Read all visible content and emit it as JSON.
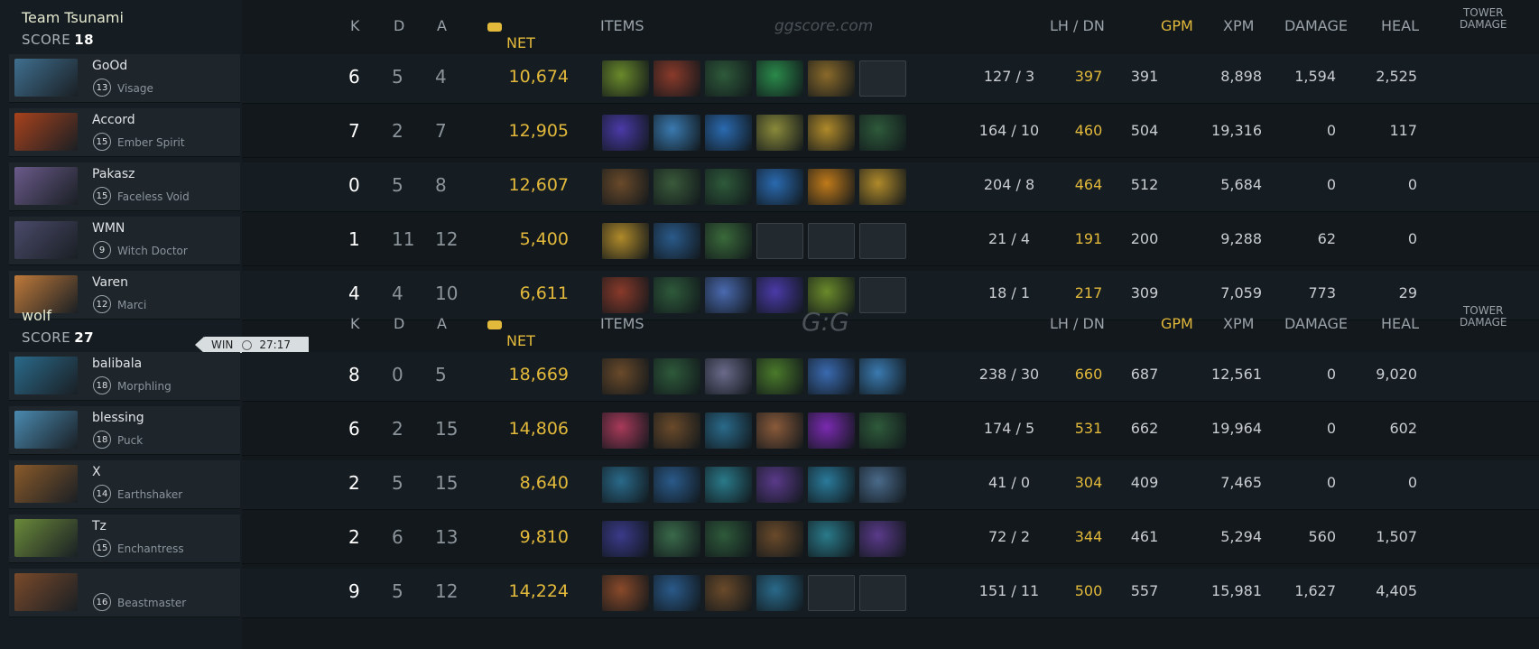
{
  "teams": [
    {
      "name": "Team Tsunami",
      "score_label": "SCORE",
      "score": "18",
      "headers": {
        "k": "K",
        "d": "D",
        "a": "A",
        "net": "NET",
        "items": "ITEMS",
        "lh": "LH  /  DN",
        "gpm": "GPM",
        "xpm": "XPM",
        "damage": "DAMAGE",
        "heal": "HEAL",
        "tower1": "TOWER",
        "tower2": "DAMAGE",
        "logo": "ggscore.com"
      },
      "players": [
        {
          "name": "GoOd",
          "level": "13",
          "hero": "Visage",
          "k": "6",
          "d": "5",
          "a": "4",
          "net": "10,674",
          "lh": "127  /  3",
          "gpm": "397",
          "xpm": "391",
          "damage": "8,898",
          "heal": "1,594",
          "tower": "2,525",
          "portrait": "#3f6f8f",
          "items": [
            "#6a8a2a",
            "#8a3a2a",
            "#2e5a3a",
            "#2a8a4a",
            "#8a6a2a",
            ""
          ]
        },
        {
          "name": "Accord",
          "level": "15",
          "hero": "Ember Spirit",
          "k": "7",
          "d": "2",
          "a": "7",
          "net": "12,905",
          "lh": "164  /  10",
          "gpm": "460",
          "xpm": "504",
          "damage": "19,316",
          "heal": "0",
          "tower": "117",
          "portrait": "#a8421c",
          "items": [
            "#4a3aa8",
            "#3a7ab0",
            "#2a6ab0",
            "#8a8a3a",
            "#b08a2a",
            "#2e5a3a"
          ]
        },
        {
          "name": "Pakasz",
          "level": "15",
          "hero": "Faceless Void",
          "k": "0",
          "d": "5",
          "a": "8",
          "net": "12,607",
          "lh": "204  /  8",
          "gpm": "464",
          "xpm": "512",
          "damage": "5,684",
          "heal": "0",
          "tower": "0",
          "portrait": "#6a5a8a",
          "items": [
            "#6a4a2a",
            "#3a5a3a",
            "#2e5a3a",
            "#2a6ab0",
            "#c07a1a",
            "#b08a2a"
          ]
        },
        {
          "name": "WMN",
          "level": "9",
          "hero": "Witch Doctor",
          "k": "1",
          "d": "11",
          "a": "12",
          "net": "5,400",
          "lh": "21  /  4",
          "gpm": "191",
          "xpm": "200",
          "damage": "9,288",
          "heal": "62",
          "tower": "0",
          "portrait": "#4a4a6a",
          "items": [
            "#b08a2a",
            "#2a5a8a",
            "#3a6a3a",
            "",
            "",
            ""
          ]
        },
        {
          "name": "Varen",
          "level": "12",
          "hero": "Marci",
          "k": "4",
          "d": "4",
          "a": "10",
          "net": "6,611",
          "lh": "18  /  1",
          "gpm": "217",
          "xpm": "309",
          "damage": "7,059",
          "heal": "773",
          "tower": "29",
          "portrait": "#c07a3a",
          "items": [
            "#8a3a2a",
            "#2e5a3a",
            "#4a6ab0",
            "#4a3aa8",
            "#6a8a2a",
            ""
          ]
        }
      ]
    },
    {
      "name": "wolf",
      "score_label": "SCORE",
      "score": "27",
      "win": "WIN",
      "time": "27:17",
      "headers": {
        "k": "K",
        "d": "D",
        "a": "A",
        "net": "NET",
        "items": "ITEMS",
        "lh": "LH  /  DN",
        "gpm": "GPM",
        "xpm": "XPM",
        "damage": "DAMAGE",
        "heal": "HEAL",
        "tower1": "TOWER",
        "tower2": "DAMAGE",
        "logo": "G:G"
      },
      "players": [
        {
          "name": "balibala",
          "level": "18",
          "hero": "Morphling",
          "k": "8",
          "d": "0",
          "a": "5",
          "net": "18,669",
          "lh": "238  /  30",
          "gpm": "660",
          "xpm": "687",
          "damage": "12,561",
          "heal": "0",
          "tower": "9,020",
          "portrait": "#2a6a8a",
          "items": [
            "#6a4a2a",
            "#2e5a3a",
            "#6a6a8a",
            "#4a7a2a",
            "#3a6ab0",
            "#3a7ab0"
          ]
        },
        {
          "name": "blessing",
          "level": "18",
          "hero": "Puck",
          "k": "6",
          "d": "2",
          "a": "15",
          "net": "14,806",
          "lh": "174  /  5",
          "gpm": "531",
          "xpm": "662",
          "damage": "19,964",
          "heal": "0",
          "tower": "602",
          "portrait": "#4a8ab0",
          "items": [
            "#a83a5a",
            "#6a4a2a",
            "#2a6a8a",
            "#8a5a3a",
            "#7a2ab0",
            "#2e5a3a"
          ]
        },
        {
          "name": "X",
          "level": "14",
          "hero": "Earthshaker",
          "k": "2",
          "d": "5",
          "a": "15",
          "net": "8,640",
          "lh": "41  /  0",
          "gpm": "304",
          "xpm": "409",
          "damage": "7,465",
          "heal": "0",
          "tower": "0",
          "portrait": "#8a5a2a",
          "items": [
            "#2a6a8a",
            "#2a5a8a",
            "#2a7a8a",
            "#5a3a8a",
            "#2a7a9a",
            "#4a6a8a"
          ]
        },
        {
          "name": "Tz",
          "level": "15",
          "hero": "Enchantress",
          "k": "2",
          "d": "6",
          "a": "13",
          "net": "9,810",
          "lh": "72  /  2",
          "gpm": "344",
          "xpm": "461",
          "damage": "5,294",
          "heal": "560",
          "tower": "1,507",
          "portrait": "#6a8a3a",
          "items": [
            "#3a3a8a",
            "#3a6a4a",
            "#2e5a3a",
            "#6a4a2a",
            "#2a7a8a",
            "#5a3a8a"
          ]
        },
        {
          "name": "",
          "level": "16",
          "hero": "Beastmaster",
          "k": "9",
          "d": "5",
          "a": "12",
          "net": "14,224",
          "lh": "151  /  11",
          "gpm": "500",
          "xpm": "557",
          "damage": "15,981",
          "heal": "1,627",
          "tower": "4,405",
          "portrait": "#7a4a2a",
          "items": [
            "#8a4a2a",
            "#2a5a8a",
            "#6a4a2a",
            "#2a6a8a",
            "",
            ""
          ]
        }
      ]
    }
  ]
}
